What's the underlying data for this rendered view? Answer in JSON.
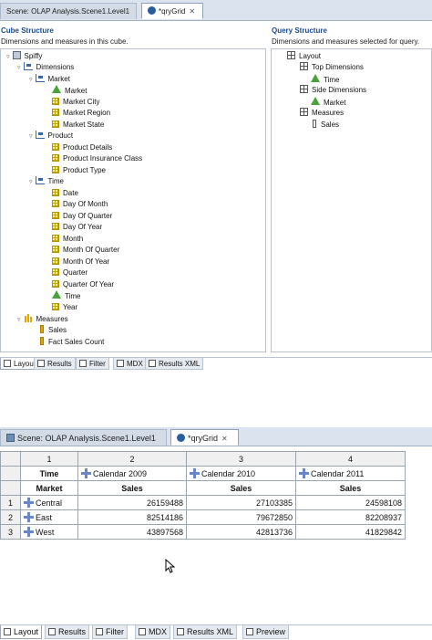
{
  "top_editor": {
    "tabs": [
      {
        "label": "Scene: OLAP Analysis.Scene1.Level1",
        "active": false
      },
      {
        "label": "*qryGrid",
        "active": true
      }
    ],
    "cube_structure": {
      "title": "Cube Structure",
      "subtitle": "Dimensions and measures in this cube.",
      "tree": {
        "root": "Spiffy",
        "dimensions_label": "Dimensions",
        "market": {
          "label": "Market",
          "children": [
            "Market",
            "Market City",
            "Market Region",
            "Market State"
          ]
        },
        "product": {
          "label": "Product",
          "children": [
            "Product Details",
            "Product Insurance Class",
            "Product Type"
          ]
        },
        "time": {
          "label": "Time",
          "children": [
            "Date",
            "Day Of Month",
            "Day Of Quarter",
            "Day Of Year",
            "Month",
            "Month Of Quarter",
            "Month Of Year",
            "Quarter",
            "Quarter Of Year",
            "Time",
            "Year"
          ]
        },
        "measures_label": "Measures",
        "measures": [
          "Sales",
          "Fact Sales Count"
        ]
      }
    },
    "query_structure": {
      "title": "Query Structure",
      "subtitle": "Dimensions and measures selected for query.",
      "tree": {
        "layout": "Layout",
        "top_dimensions": "Top Dimensions",
        "top_child": "Time",
        "side_dimensions": "Side Dimensions",
        "side_child": "Market",
        "measures": "Measures",
        "measures_child": "Sales"
      }
    },
    "bottom_tabs": [
      "Layout",
      "Results",
      "Filter",
      "MDX",
      "Results XML"
    ],
    "active_bottom_tab": "Layout"
  },
  "bottom_editor": {
    "tabs": [
      {
        "label": "Scene: OLAP Analysis.Scene1.Level1",
        "active": false
      },
      {
        "label": "*qryGrid",
        "active": true
      }
    ],
    "grid": {
      "column_numbers": [
        "1",
        "2",
        "3",
        "4"
      ],
      "row_header_label": "Time",
      "market_label": "Market",
      "columns": [
        "Calendar 2009",
        "Calendar 2010",
        "Calendar 2011"
      ],
      "measure_label": "Sales",
      "rows": [
        {
          "num": "1",
          "label": "Central",
          "values": [
            "26159488",
            "27103385",
            "24598108"
          ]
        },
        {
          "num": "2",
          "label": "East",
          "values": [
            "82514186",
            "79672850",
            "82208937"
          ]
        },
        {
          "num": "3",
          "label": "West",
          "values": [
            "43897568",
            "42813736",
            "41829842"
          ]
        }
      ]
    },
    "bottom_tabs": [
      "Layout",
      "Results",
      "Filter",
      "MDX",
      "Results XML",
      "Preview"
    ],
    "active_bottom_tab": "Layout"
  }
}
